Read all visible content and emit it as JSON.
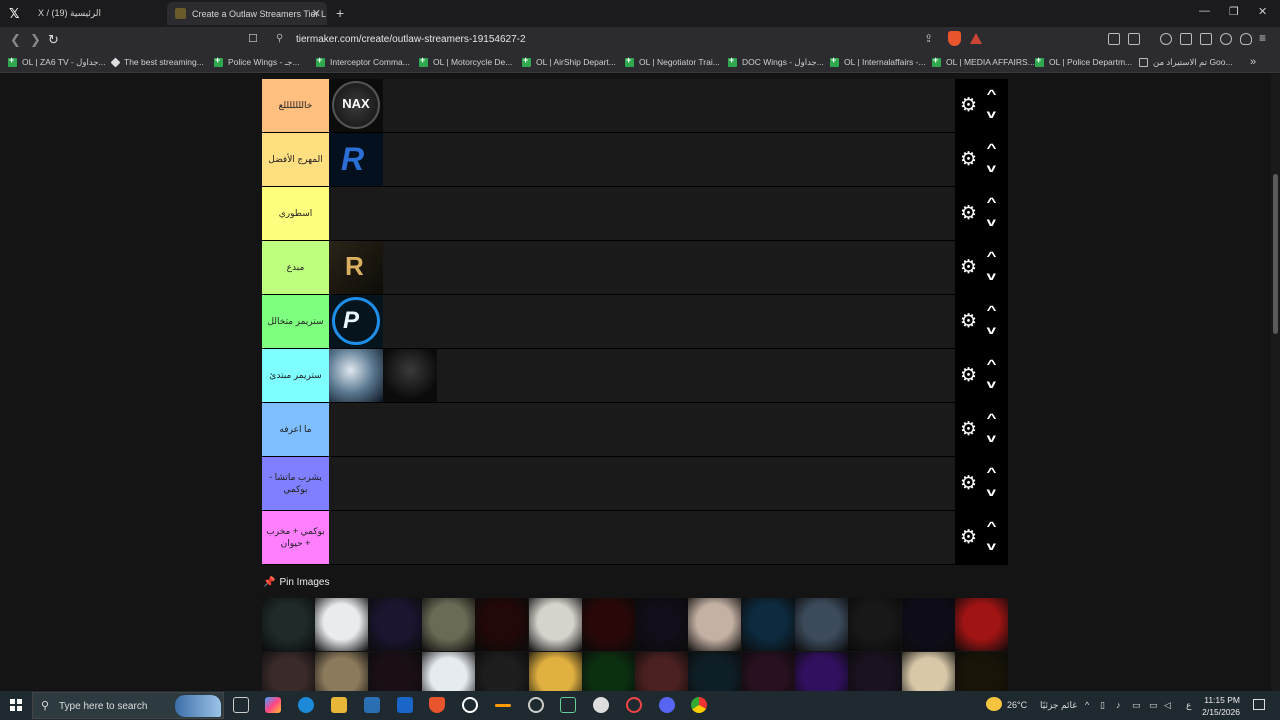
{
  "browser": {
    "tabs": [
      {
        "title": "X / الرئيسية (19)",
        "active": false
      },
      {
        "title": "Create a Outlaw Streamers Tier L",
        "active": true
      }
    ],
    "url": "tiermaker.com/create/outlaw-streamers-19154627-2",
    "bookmarks": [
      {
        "label": "OL | ZA6 TV - جداول...",
        "icon": "sheets-icon"
      },
      {
        "label": "The best streaming...",
        "icon": "diamond-icon"
      },
      {
        "label": "Police Wings - جـ...",
        "icon": "sheets-icon"
      },
      {
        "label": "Interceptor Comma...",
        "icon": "sheets-icon"
      },
      {
        "label": "OL | Motorcycle De...",
        "icon": "sheets-icon"
      },
      {
        "label": "OL | AirShip Depart...",
        "icon": "sheets-icon"
      },
      {
        "label": "OL | Negotiator Trai...",
        "icon": "sheets-icon"
      },
      {
        "label": "DOC Wings - جداول...",
        "icon": "sheets-icon"
      },
      {
        "label": "OL | Internalaffairs -...",
        "icon": "sheets-icon"
      },
      {
        "label": "OL | MEDIA AFFAIRS...",
        "icon": "sheets-icon"
      },
      {
        "label": "OL | Police Departm...",
        "icon": "sheets-icon"
      },
      {
        "label": "تم الاستيراد من Goo...",
        "icon": "folder-icon"
      }
    ]
  },
  "tiers": [
    {
      "label": "خالللللللع",
      "color": "#ffbf7f",
      "items": [
        {
          "name": "nax-logo",
          "kind": "nax"
        }
      ]
    },
    {
      "label": "المهرج الأفضل",
      "color": "#ffdf7f",
      "items": [
        {
          "name": "blue-r-logo",
          "kind": "bluer"
        }
      ]
    },
    {
      "label": "اسطوري",
      "color": "#ffff7f",
      "items": []
    },
    {
      "label": "مبدع",
      "color": "#bfff7f",
      "items": [
        {
          "name": "gold-r-logo",
          "kind": "goldr"
        }
      ]
    },
    {
      "label": "ستريمر متخالل",
      "color": "#7fff7f",
      "items": [
        {
          "name": "pd-logo",
          "kind": "pd"
        }
      ]
    },
    {
      "label": "ستريمر مبتدئ",
      "color": "#7fffff",
      "items": [
        {
          "name": "anime-avatar",
          "kind": "anime"
        },
        {
          "name": "dark-flowers",
          "kind": "dark"
        }
      ]
    },
    {
      "label": "ما اعرفه",
      "color": "#7fbfff",
      "items": []
    },
    {
      "label": "يشرب ماتشا - بوكمي",
      "color": "#7f7fff",
      "items": []
    },
    {
      "label": "بوكمي + مخرب + حيوان",
      "color": "#ff7fff",
      "items": []
    }
  ],
  "pin_images_label": "Pin Images",
  "pool_row1": [
    "#1f2a2a",
    "#e9ecef",
    "#1b1530",
    "#6b6a55",
    "#220808",
    "#d6d2cc",
    "#2a0707",
    "#120d18",
    "#c5b1a4",
    "#0d2a3e",
    "#3c4b5c",
    "#181818",
    "#0f0c1a",
    "#a01414"
  ],
  "pool_row2": [
    "#3a2a2a",
    "#8c7a5c",
    "#1a0f16",
    "#e6ebf0",
    "#1d1d1d",
    "#e0b040",
    "#0b3010",
    "#4a2020",
    "#0e1e26",
    "#281020",
    "#321060",
    "#1a1220",
    "#d8c8a8",
    "#181408"
  ],
  "taskbar": {
    "search_placeholder": "Type here to search",
    "weather": "26°C",
    "weather_desc": "غائم جزئيًا",
    "lang": "ع",
    "time": "11:15 PM",
    "date": "2/15/2026"
  }
}
